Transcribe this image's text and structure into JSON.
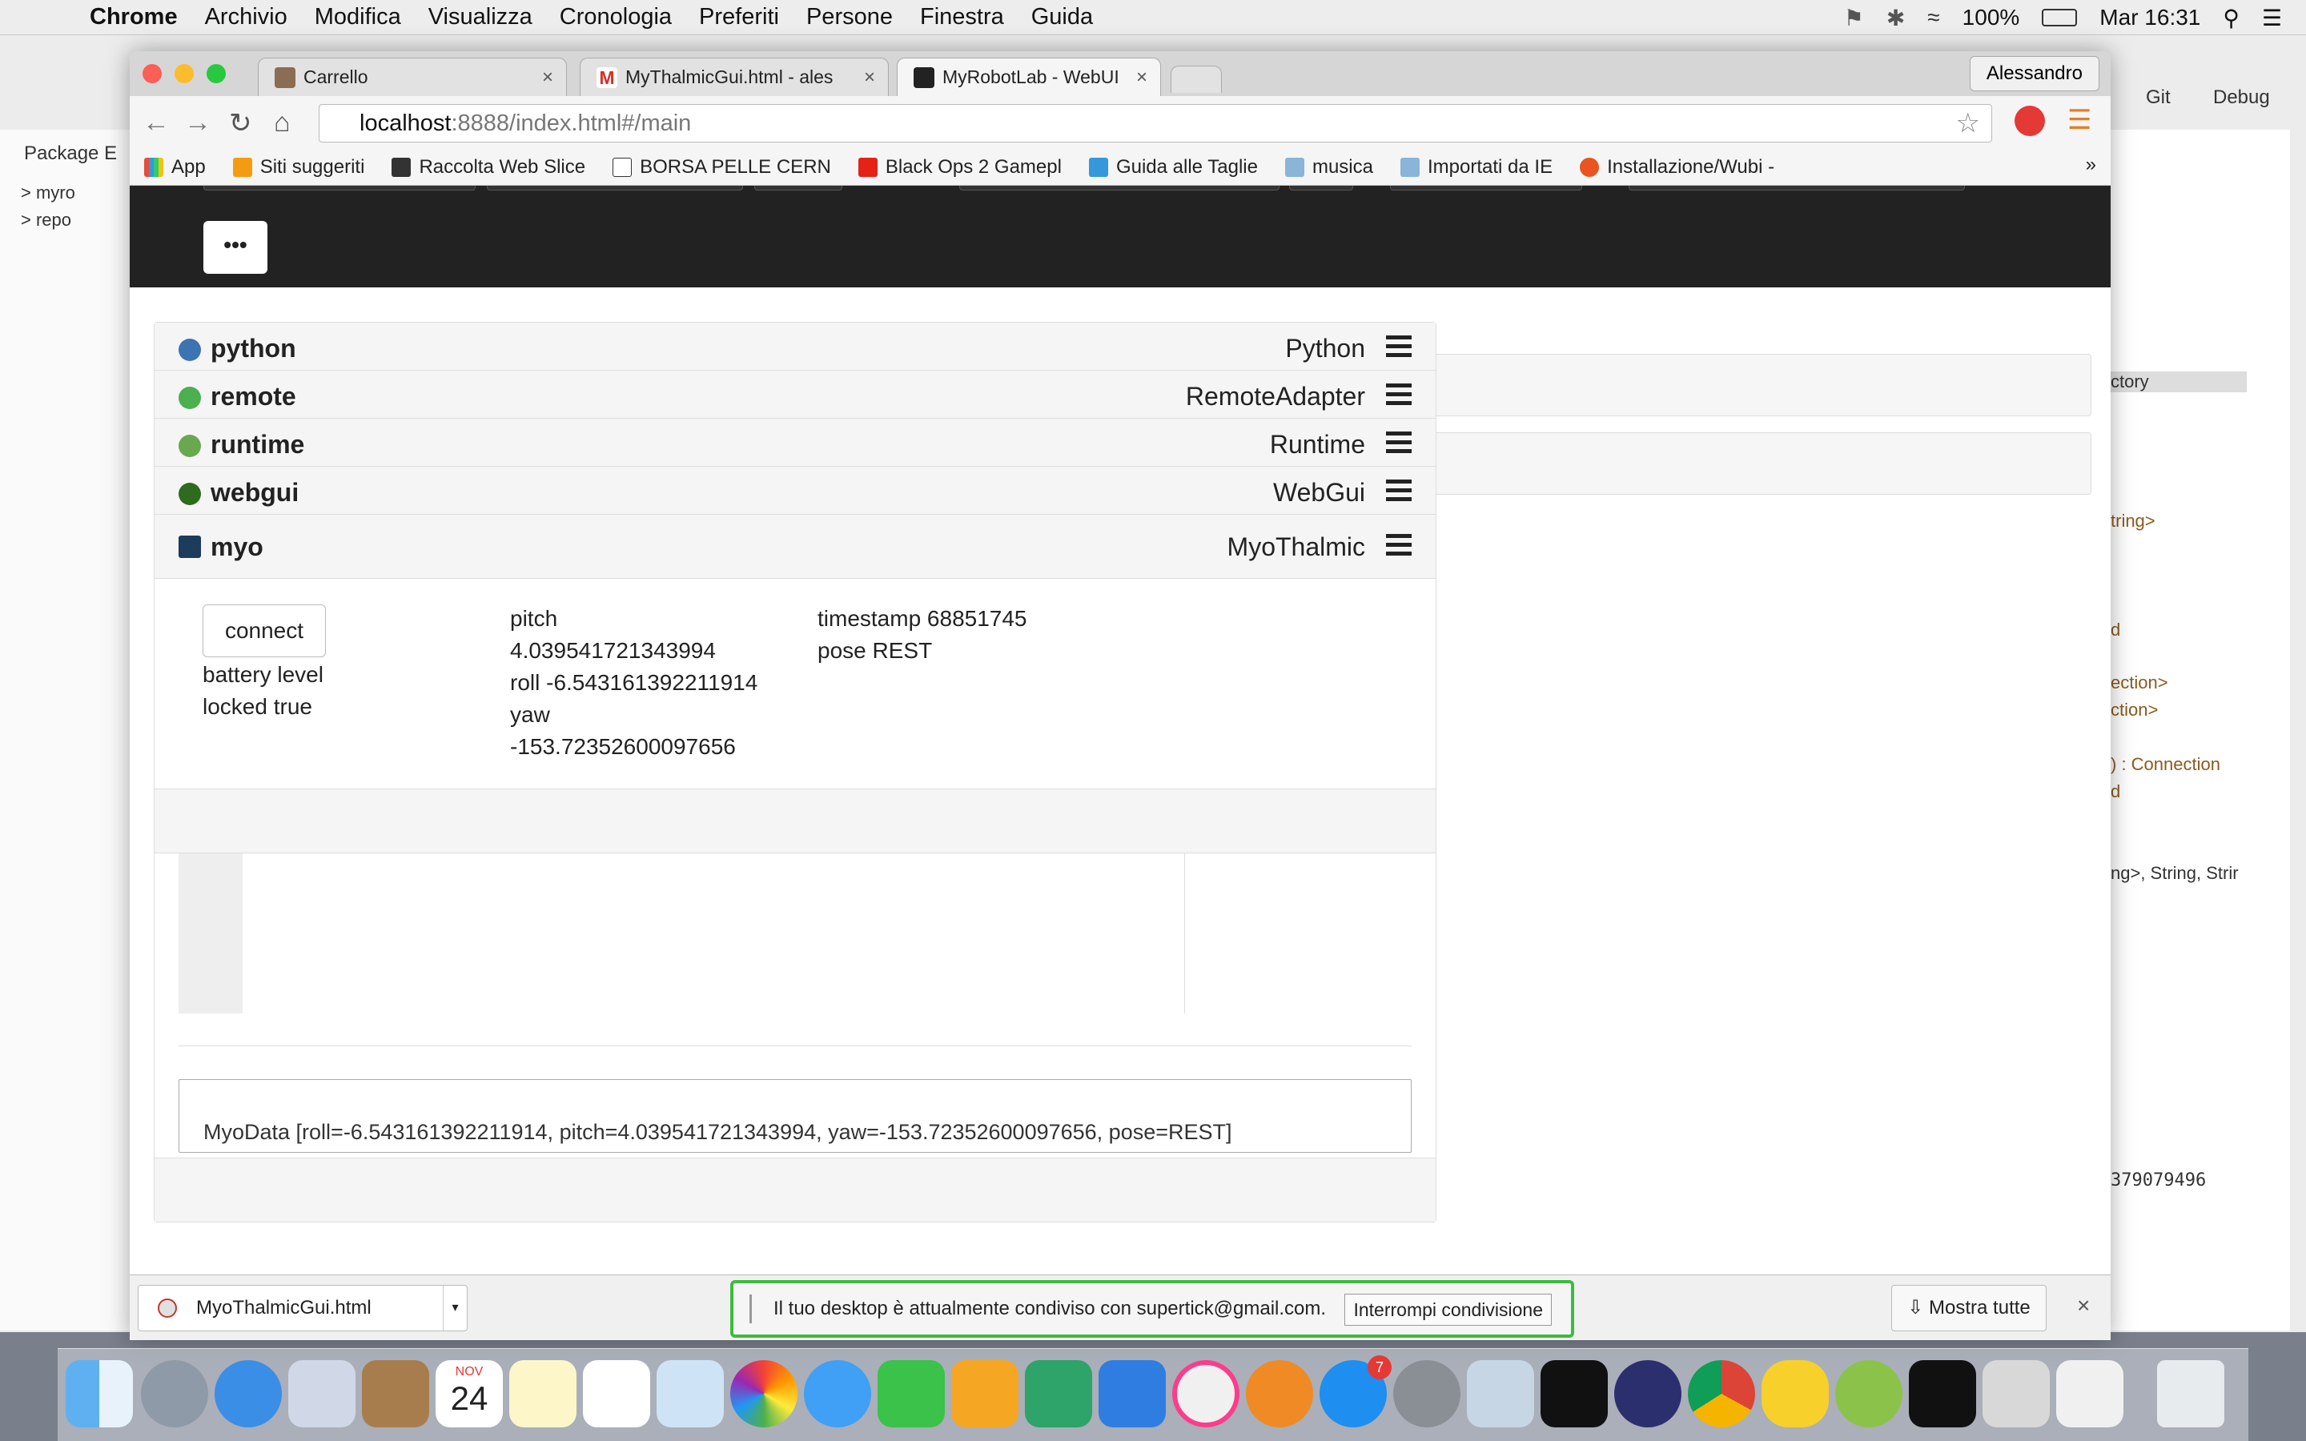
{
  "menubar": {
    "app": "Chrome",
    "items": [
      "Archivio",
      "Modifica",
      "Visualizza",
      "Cronologia",
      "Preferiti",
      "Persone",
      "Finestra",
      "Guida"
    ],
    "battery": "100%",
    "clock": "Mar 16:31"
  },
  "eclipse": {
    "package_explorer": "Package E",
    "tree_items": [
      "> myro",
      "> repo"
    ],
    "git": "Git",
    "debug": "Debug",
    "snippets": [
      "ctory",
      "tring>",
      "d",
      "ection>",
      "ction>",
      ") : Connection",
      "d",
      "ng>, String, Strir",
      "379079496"
    ]
  },
  "chrome": {
    "tabs": [
      {
        "title": "Carrello",
        "active": false
      },
      {
        "title": "MyThalmicGui.html - ales",
        "active": false
      },
      {
        "title": "MyRobotLab - WebUI",
        "active": true
      }
    ],
    "user": "Alessandro",
    "url_host": "localhost",
    "url_rest": ":8888/index.html#/main",
    "bookmarks": [
      "App",
      "Siti suggeriti",
      "Raccolta Web Slice",
      "BORSA PELLE CERN",
      "Black Ops 2 Gamepl",
      "Guida alle Taglie",
      "musica",
      "Importati da IE",
      "Installazione/Wubi - "
    ],
    "bookmarks_overflow": "»"
  },
  "page": {
    "more_button": "•••",
    "services": [
      {
        "name": "python",
        "type": "Python",
        "color": "#3b73b3"
      },
      {
        "name": "remote",
        "type": "RemoteAdapter",
        "color": "#4caf50"
      },
      {
        "name": "runtime",
        "type": "Runtime",
        "color": "#6aa84f"
      },
      {
        "name": "webgui",
        "type": "WebGui",
        "color": "#2e6b1e"
      },
      {
        "name": "myo",
        "type": "MyoThalmic",
        "color": "#1d3b5a"
      }
    ],
    "myo": {
      "connect_label": "connect",
      "battery": "battery level",
      "locked": "locked true",
      "pitch_label": "pitch",
      "pitch_value": "4.039541721343994",
      "roll": "roll -6.543161392211914",
      "yaw_label": "yaw",
      "yaw_value": "-153.72352600097656",
      "timestamp": "timestamp 68851745",
      "pose": "pose REST"
    },
    "log": "MyoData [roll=-6.543161392211914, pitch=4.039541721343994, yaw=-153.72352600097656, pose=REST]"
  },
  "downloads": {
    "file": "MyoThalmicGui.html",
    "share_text": "Il tuo desktop è attualmente condiviso con supertick@gmail.com.",
    "stop_share": "Interrompi condivisione",
    "show_all": "Mostra tutte",
    "close": "×"
  },
  "dock": {
    "calendar_month": "NOV",
    "calendar_day": "24",
    "appstore_badge": "7"
  }
}
